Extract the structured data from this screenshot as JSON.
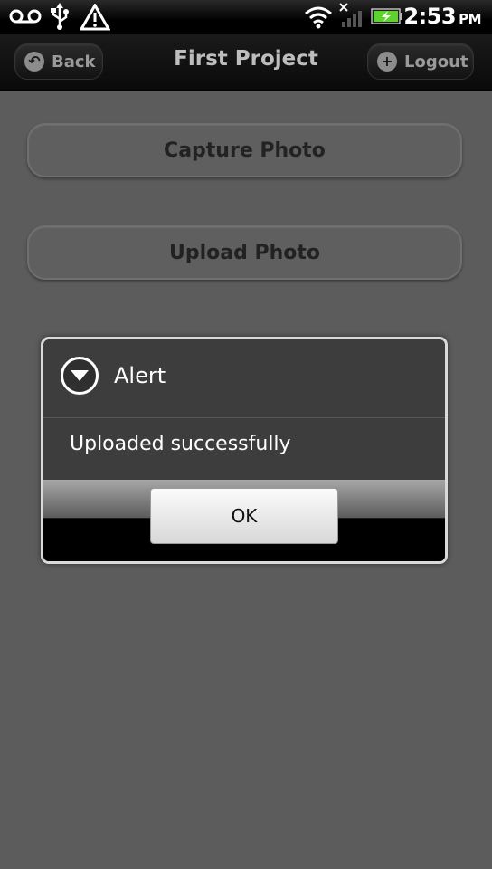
{
  "status_bar": {
    "icons": [
      "voicemail-icon",
      "usb-icon",
      "warning-icon",
      "wifi-icon",
      "no-signal-icon",
      "battery-charging-icon"
    ],
    "time": "2:53",
    "ampm": "PM"
  },
  "header": {
    "title": "First Project",
    "back_label": "Back",
    "logout_label": "Logout"
  },
  "main": {
    "capture_label": "Capture Photo",
    "upload_label": "Upload Photo"
  },
  "dialog": {
    "title": "Alert",
    "message": "Uploaded successfully",
    "ok_label": "OK"
  },
  "colors": {
    "background": "#5c5c5c",
    "battery_green": "#5fd32d"
  }
}
